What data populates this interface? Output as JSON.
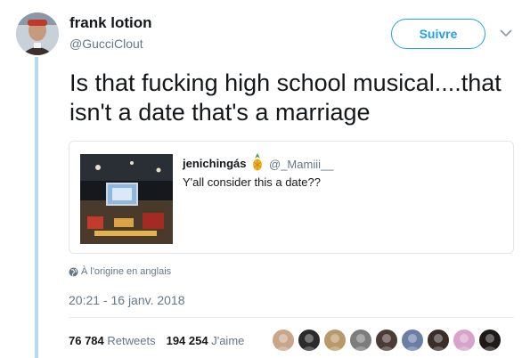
{
  "author": {
    "name": "frank lotion",
    "handle": "@GucciClout",
    "avatar_icon": "user-avatar-photo"
  },
  "follow_button": {
    "label": "Suivre",
    "color": "#1da1f2"
  },
  "menu_icon": "chevron-down-icon",
  "tweet": {
    "text": "Is that fucking high school musical....that isn't a date that's a marriage"
  },
  "quoted_tweet": {
    "name": "jenichingás",
    "name_emoji_icon": "pineapple-emoji",
    "handle": "@_Mamiii__",
    "text": "Y'all consider this a date??",
    "image_icon": "car-dashboard-tablet-photo"
  },
  "translation": {
    "label": "À l'origine en anglais",
    "icon": "globe-icon"
  },
  "timestamp": "20:21 - 16 janv. 2018",
  "stats": {
    "retweets_count": "76 784",
    "retweets_label": "Retweets",
    "likes_count": "194 254",
    "likes_label": "J'aime"
  },
  "likers": [
    {
      "icon": "liker-avatar-1",
      "color": "#c9a58a"
    },
    {
      "icon": "liker-avatar-2",
      "color": "#2b2b2b"
    },
    {
      "icon": "liker-avatar-3",
      "color": "#b89a6a"
    },
    {
      "icon": "liker-avatar-4",
      "color": "#7d7d7d"
    },
    {
      "icon": "liker-avatar-5",
      "color": "#4a3b36"
    },
    {
      "icon": "liker-avatar-6",
      "color": "#6b7fa5"
    },
    {
      "icon": "liker-avatar-7",
      "color": "#3a2d2a"
    },
    {
      "icon": "liker-avatar-8",
      "color": "#d7a3c8"
    },
    {
      "icon": "liker-avatar-9",
      "color": "#1f1a17"
    }
  ]
}
